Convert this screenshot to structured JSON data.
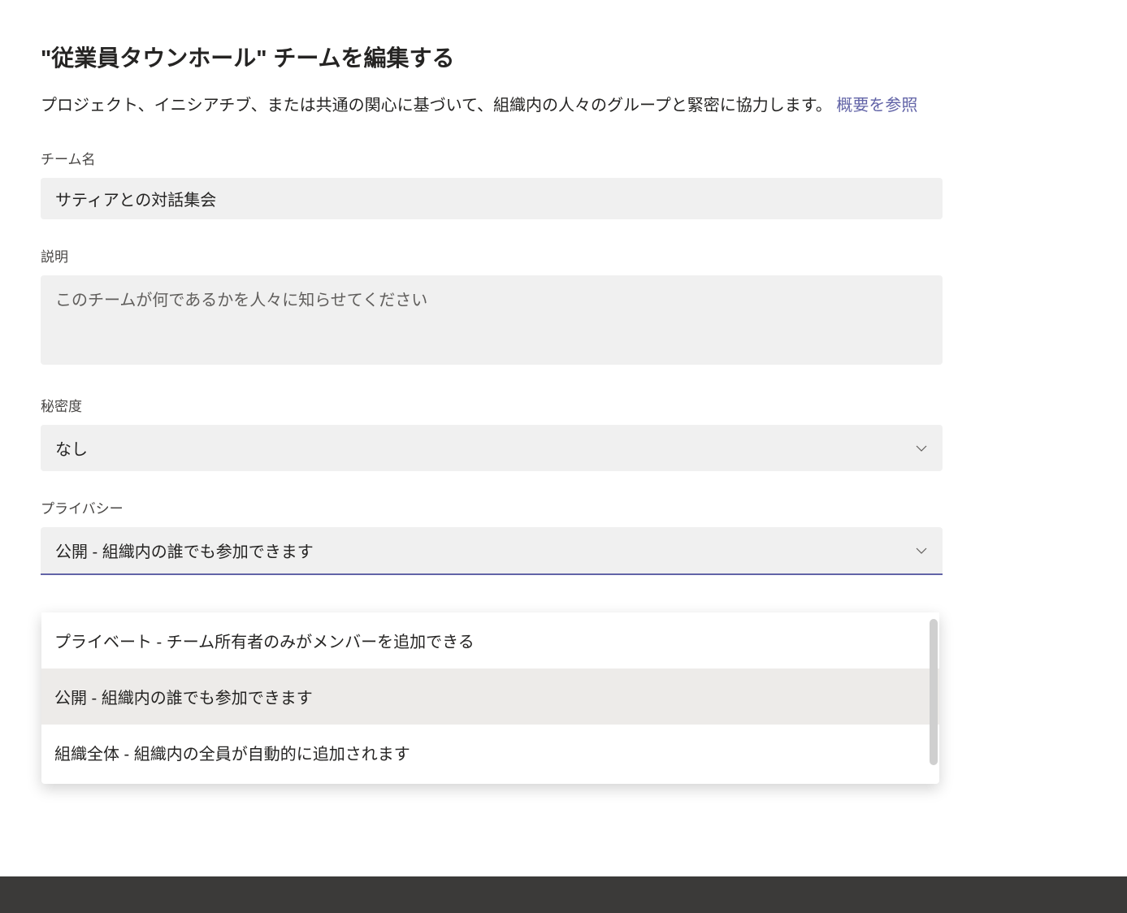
{
  "dialog": {
    "title": "\"従業員タウンホール\" チームを編集する",
    "subtitle_text": "プロジェクト、イニシアチブ、または共通の関心に基づいて、組織内の人々のグループと緊密に協力します。 ",
    "subtitle_link": "概要を参照"
  },
  "team_name": {
    "label": "チーム名",
    "value": "サティアとの対話集会"
  },
  "description": {
    "label": "説明",
    "placeholder": "このチームが何であるかを人々に知らせてください",
    "value": ""
  },
  "sensitivity": {
    "label": "秘密度",
    "selected": "なし"
  },
  "privacy": {
    "label": "プライバシー",
    "selected": "公開 - 組織内の誰でも参加できます",
    "options": [
      "プライベート - チーム所有者のみがメンバーを追加できる",
      "公開 - 組織内の誰でも参加できます",
      "組織全体 - 組織内の全員が自動的に追加されます"
    ]
  }
}
